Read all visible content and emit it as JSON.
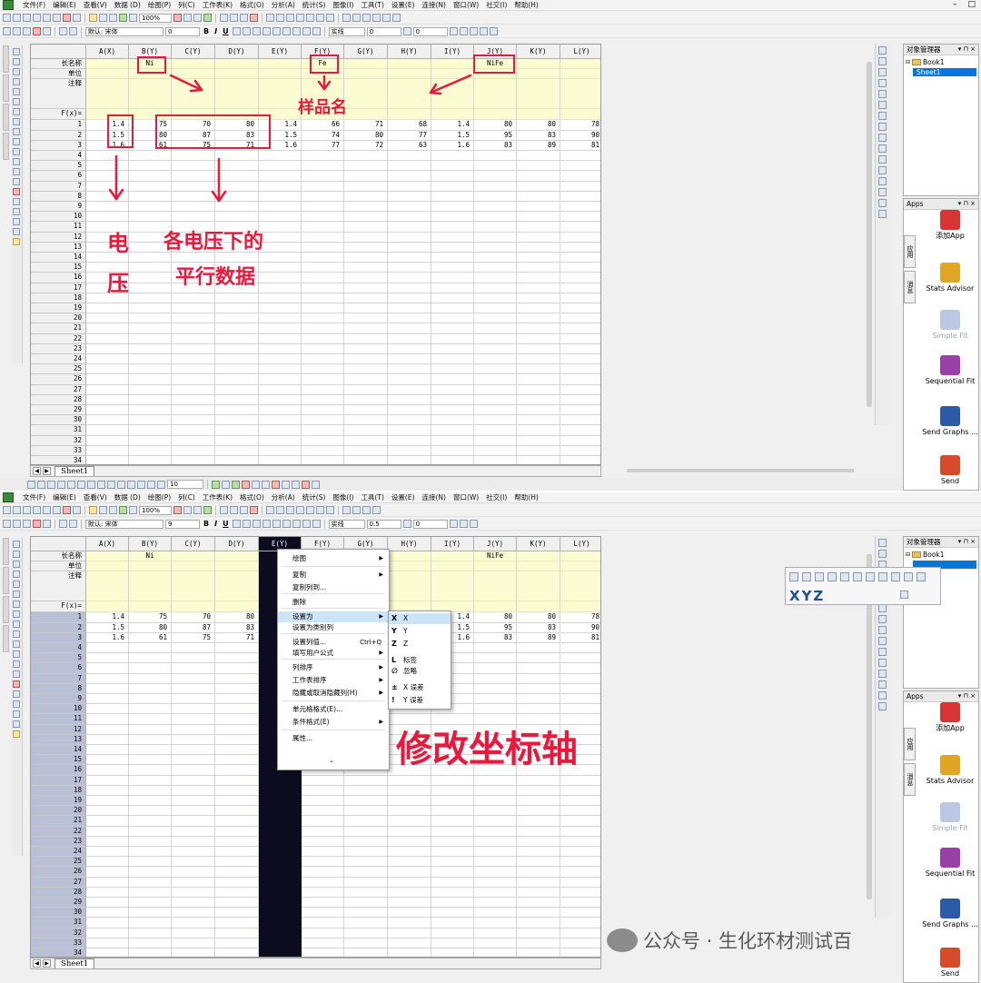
{
  "menus": [
    "文件(F)",
    "编辑(E)",
    "查看(V)",
    "数据 (D)",
    "绘图(P)",
    "列(C)",
    "工作表(K)",
    "格式(O)",
    "分析(A)",
    "统计(S)",
    "图像(I)",
    "工具(T)",
    "设置(E)",
    "连接(N)",
    "窗口(W)",
    "社交(I)",
    "帮助(H)"
  ],
  "toolbar": {
    "zoom": "100%",
    "font_default": "默认: 宋体",
    "font_size_top": "0",
    "font_size_bot": "9",
    "bold": "B",
    "italic": "I",
    "underline": "U",
    "line_style": "实线",
    "line_width_top": "0",
    "line_width_bot": "0.5",
    "zero_top": "0",
    "zero_bot": "0",
    "bottom_field": "10"
  },
  "sheet": {
    "columns": [
      "A(X)",
      "B(Y)",
      "C(Y)",
      "D(Y)",
      "E(Y)",
      "F(Y)",
      "G(Y)",
      "H(Y)",
      "I(Y)",
      "J(Y)",
      "K(Y)",
      "L(Y)"
    ],
    "meta_labels": [
      "长名称",
      "单位",
      "注释",
      "F(x)="
    ],
    "long_names_top": [
      "",
      "Ni",
      "",
      "",
      "",
      "Fe",
      "",
      "",
      "",
      "NiFe",
      "",
      ""
    ],
    "long_names_bot": [
      "",
      "Ni",
      "",
      "",
      "",
      "",
      "",
      "",
      "",
      "NiFe",
      "",
      ""
    ],
    "rows": [
      [
        "1.4",
        "75",
        "70",
        "80",
        "1.4",
        "66",
        "71",
        "68",
        "1.4",
        "80",
        "80",
        "78"
      ],
      [
        "1.5",
        "80",
        "87",
        "83",
        "1.5",
        "74",
        "80",
        "77",
        "1.5",
        "95",
        "83",
        "90"
      ],
      [
        "1.6",
        "61",
        "75",
        "71",
        "1.6",
        "77",
        "72",
        "63",
        "1.6",
        "83",
        "89",
        "81"
      ]
    ],
    "row_count": 34,
    "tab_label": "Sheet1"
  },
  "object_manager": {
    "title": "对象管理器",
    "book": "Book1",
    "sheet": "Sheet1"
  },
  "apps_panel": {
    "title": "Apps",
    "vtab_a": "应用",
    "vtab_b": "消息",
    "items": [
      {
        "label": "添加App",
        "color": "#d83434"
      },
      {
        "label": "Stats Advisor",
        "color": "#e0a623"
      },
      {
        "label": "Simple Fit",
        "color": "#bcc7e6"
      },
      {
        "label": "Sequential Fit",
        "color": "#9b3fa8"
      },
      {
        "label": "Send Graphs ...",
        "color": "#2b5aa8"
      },
      {
        "label": "Send",
        "color": "#d84b2a"
      }
    ]
  },
  "annotations": {
    "sample_name": "样品名",
    "voltage_a": "电",
    "voltage_b": "压",
    "parallel_a": "各电压下的",
    "parallel_b": "平行数据",
    "modify_axis": "修改坐标轴"
  },
  "context_menu": {
    "items": [
      {
        "label": "绘图",
        "sub": true
      },
      {
        "label": "复制",
        "sub": true
      },
      {
        "label": "复制列到...",
        "sub": false
      },
      {
        "label": "删除",
        "sub": false
      },
      {
        "label": "设置为",
        "sub": true
      },
      {
        "label": "设置为类别列",
        "sub": false
      },
      {
        "label": "设置列值...",
        "sub": false,
        "shortcut": "Ctrl+Q"
      },
      {
        "label": "填写用户公式",
        "sub": true
      },
      {
        "label": "列排序",
        "sub": true
      },
      {
        "label": "工作表排序",
        "sub": true
      },
      {
        "label": "隐藏或取消隐藏列(H)",
        "sub": true
      },
      {
        "label": "单元格格式(E)...",
        "sub": false
      },
      {
        "label": "条件格式(E)",
        "sub": true
      },
      {
        "label": "属性...",
        "sub": false
      }
    ],
    "submenu": [
      {
        "key": "X",
        "label": "X"
      },
      {
        "key": "Y",
        "label": "Y"
      },
      {
        "key": "Z",
        "label": "Z"
      },
      {
        "key": "L",
        "label": "标签"
      },
      {
        "key": "∅",
        "label": "忽略"
      },
      {
        "key": "±",
        "label": "X 误差"
      },
      {
        "key": "!",
        "label": "Y 误差"
      }
    ]
  },
  "float_toolbar": {
    "xyz": "XYZ"
  },
  "watermark": "公众号 · 生化环材测试百"
}
